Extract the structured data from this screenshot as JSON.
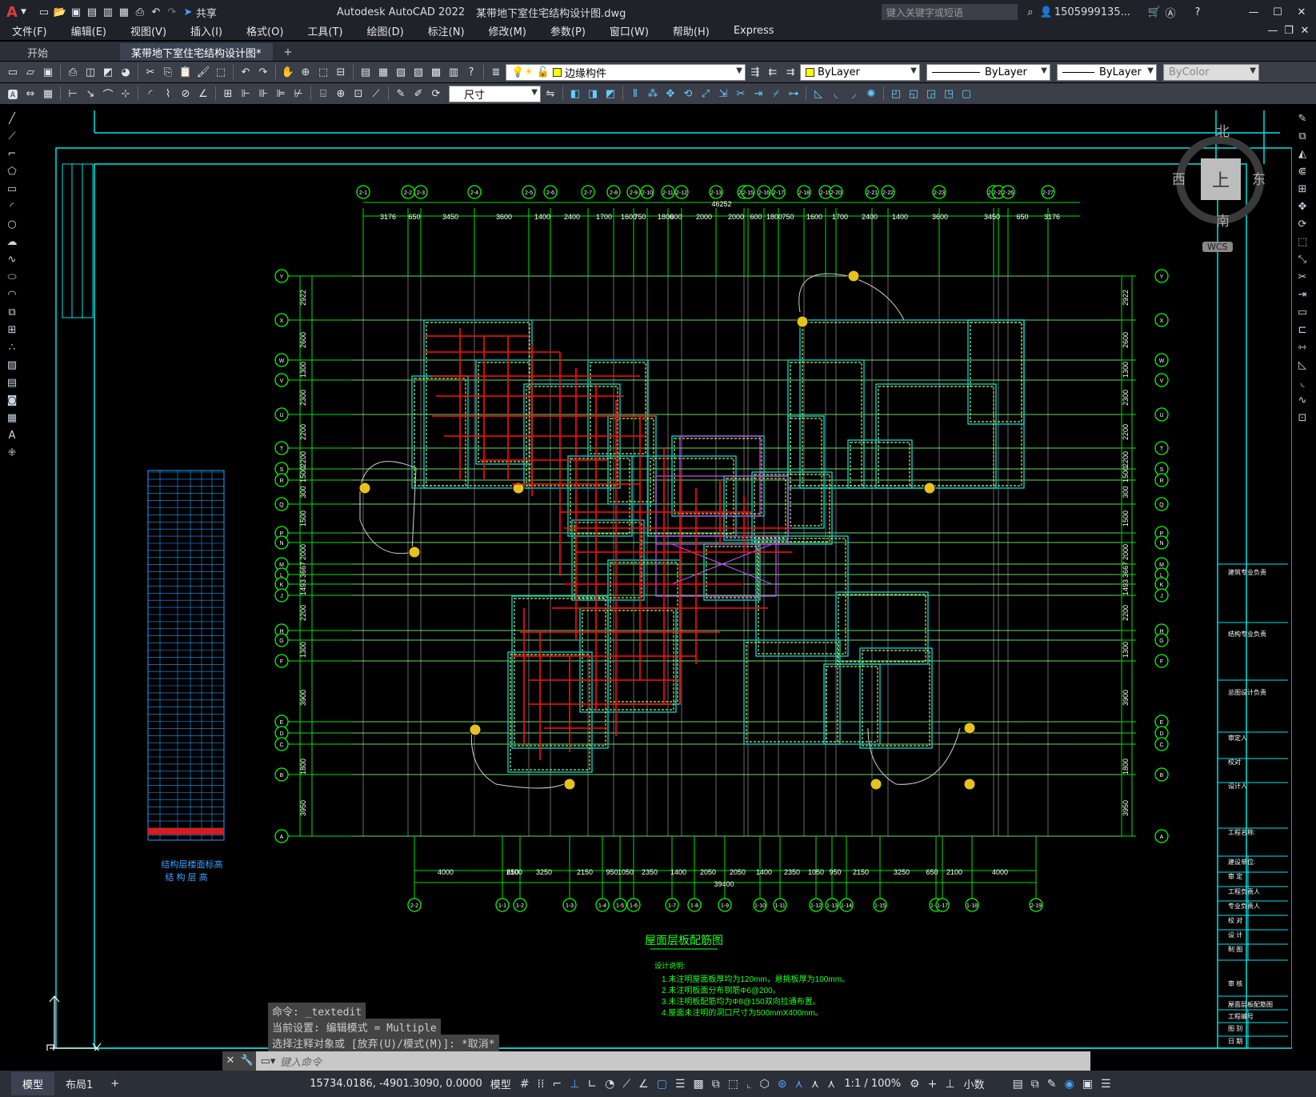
{
  "title": {
    "app": "Autodesk AutoCAD 2022",
    "file": "某带地下室住宅结构设计图.dwg",
    "search_placeholder": "键入关键字或短语",
    "user": "1505999135...",
    "share": "共享"
  },
  "menu": [
    "文件(F)",
    "编辑(E)",
    "视图(V)",
    "插入(I)",
    "格式(O)",
    "工具(T)",
    "绘图(D)",
    "标注(N)",
    "修改(M)",
    "参数(P)",
    "窗口(W)",
    "帮助(H)",
    "Express"
  ],
  "tabs": {
    "start": "开始",
    "doc": "某带地下室住宅结构设计图*"
  },
  "props": {
    "layer": "边缘构件",
    "color": "ByLayer",
    "linetype": "ByLayer",
    "lineweight": "ByLayer",
    "plotstyle": "ByColor",
    "dimstyle": "尺寸"
  },
  "viewcube": {
    "north": "北",
    "south": "南",
    "east": "东",
    "west": "西",
    "top": "上",
    "wcs": "WCS"
  },
  "drawing": {
    "grid_top": [
      "2-1",
      "2-2",
      "2-3",
      "2-4",
      "2-5",
      "2-6",
      "2-7",
      "2-8",
      "2-9",
      "2-10",
      "2-11",
      "2-12",
      "2-13",
      "2-14",
      "2-15",
      "2-16",
      "2-17",
      "2-18",
      "2-19",
      "2-20",
      "2-21",
      "2-22",
      "2-23",
      "2-24",
      "2-25",
      "2-26",
      "2-27"
    ],
    "grid_bottom": [
      "2-2",
      "1-1",
      "1-2",
      "1-3",
      "1-4",
      "1-5",
      "1-6",
      "1-7",
      "1-8",
      "1-9",
      "1-10",
      "1-11",
      "1-12",
      "1-13",
      "1-14",
      "1-15",
      "1-16",
      "1-17",
      "1-18",
      "2-19"
    ],
    "grid_rows": [
      "Y",
      "X",
      "W",
      "V",
      "U",
      "T",
      "S",
      "R",
      "Q",
      "P",
      "N",
      "M",
      "L",
      "K",
      "J",
      "H",
      "G",
      "F",
      "E",
      "D",
      "C",
      "B",
      "A"
    ],
    "dims_top": [
      "3176",
      "650",
      "3450",
      "3600",
      "1400",
      "2400",
      "1700",
      "1600",
      "750",
      "1800",
      "600",
      "2000",
      "2000",
      "600",
      "1800",
      "750",
      "1600",
      "1700",
      "2400",
      "1400",
      "3600",
      "3450",
      "650",
      "3176"
    ],
    "dims_top_total": "46252",
    "dims_bottom": [
      "4000",
      "2100",
      "650",
      "3250",
      "2150",
      "950",
      "1050",
      "2350",
      "1400",
      "2050",
      "2050",
      "1400",
      "2350",
      "1050",
      "950",
      "2150",
      "3250",
      "650",
      "2100",
      "4000"
    ],
    "dims_bottom_total": "39400",
    "dims_side": [
      "2922",
      "2600",
      "1300",
      "2300",
      "2200",
      "2200",
      "1500",
      "300",
      "1500",
      "2000",
      "3667",
      "1493",
      "2200",
      "1300",
      "3900",
      "1800",
      "3950"
    ],
    "plan_title": "屋面层板配筋图",
    "notes_title": "设计说明:",
    "notes": [
      "1.未注明屋面板厚均为120mm，悬挑板厚为100mm。",
      "2.未注明板面分布钢筋Φ6@200。",
      "3.未注明板配筋均为Φ8@150双向拉通布置。",
      "4.屋面未注明的洞口尺寸为500mmX400mm。"
    ],
    "table_title": "结构层楼面标高",
    "table_sub": "结 构 层 高",
    "tb_labels": [
      "建筑专业负责",
      "结构专业负责",
      "总图设计负责",
      "审定人",
      "校对",
      "设计人",
      "工程名称:",
      "建设单位:",
      "审 定",
      "工程负责人",
      "专业负责人",
      "校 对",
      "设 计",
      "制 图",
      "审 核",
      "屋面层板配筋图",
      "工程编号",
      "图 别",
      "日 期",
      "L楼团10,"
    ]
  },
  "commands": [
    "命令: _textedit",
    "当前设置: 编辑模式 = Multiple",
    "选择注释对象或 [放弃(U)/模式(M)]: *取消*"
  ],
  "cmd_placeholder": "键入命令",
  "status": {
    "model_tab": "模型",
    "layout_tab": "布局1",
    "coords": "15734.0186, -4901.3090, 0.0000",
    "model": "模型",
    "scale": "1:1 / 100%",
    "units": "小数"
  }
}
